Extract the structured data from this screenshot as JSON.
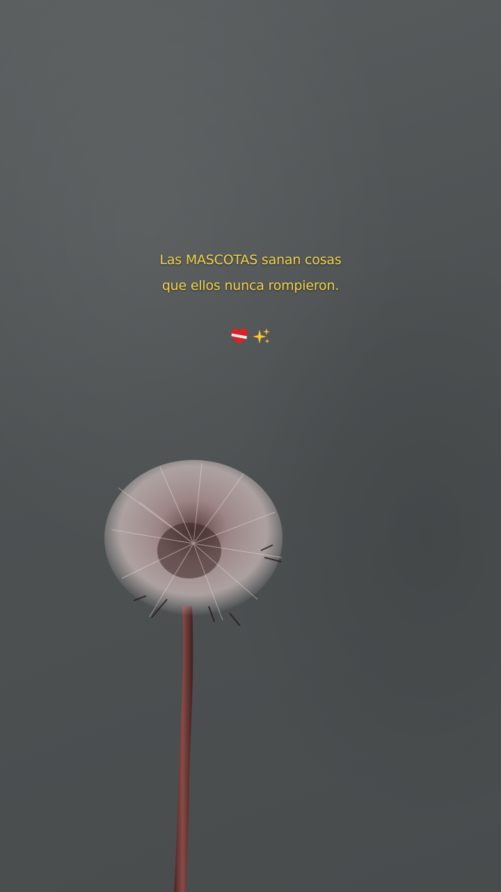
{
  "caption": {
    "line1": "Las MASCOTAS sanan cosas",
    "line2": "que ellos nunca rompieron."
  },
  "icons": {
    "heart": "bandaged-heart-icon",
    "sparkles": "sparkles-icon"
  },
  "colors": {
    "caption_text": "#f3d34a",
    "background": "#4f5354",
    "stem": "#6b3a36",
    "seed_head": "#c9b4b2"
  }
}
